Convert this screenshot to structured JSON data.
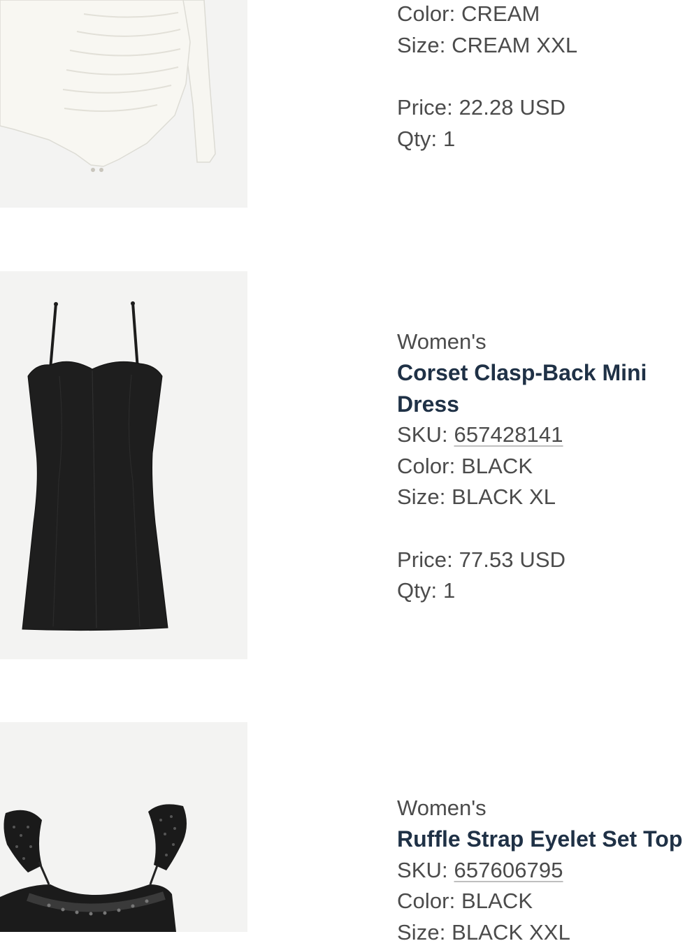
{
  "items": [
    {
      "image_icon": "white-bodysuit-image",
      "color_label": "Color:",
      "color": "CREAM",
      "size_label": "Size:",
      "size": "CREAM XXL",
      "price_label": "Price:",
      "price": "22.28 USD",
      "qty_label": "Qty:",
      "qty": "1"
    },
    {
      "image_icon": "black-mini-dress-image",
      "category": "Women's",
      "name": "Corset Clasp-Back Mini Dress",
      "sku_label": "SKU:",
      "sku": "657428141",
      "color_label": "Color:",
      "color": "BLACK",
      "size_label": "Size:",
      "size": "BLACK XL",
      "price_label": "Price:",
      "price": "77.53 USD",
      "qty_label": "Qty:",
      "qty": "1"
    },
    {
      "image_icon": "black-eyelet-top-image",
      "category": "Women's",
      "name": "Ruffle Strap Eyelet Set Top",
      "sku_label": "SKU:",
      "sku": "657606795",
      "color_label": "Color:",
      "color": "BLACK",
      "size_label": "Size:",
      "size": "BLACK XXL"
    }
  ],
  "colors": {
    "product_name": "#1f3146",
    "body_text": "#4b4b4b",
    "image_background": "#f3f3f2"
  }
}
